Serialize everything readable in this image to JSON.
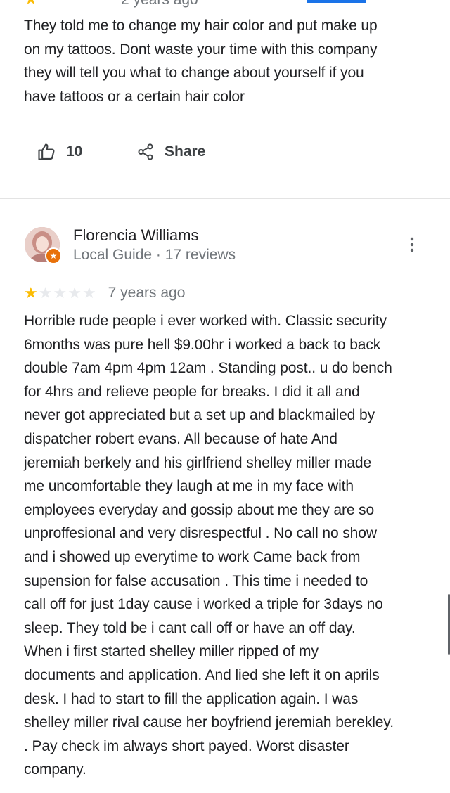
{
  "previous_review": {
    "date_cutoff": "2 years ago",
    "text": "They told me to change my hair color and put make up\non my tattoos. Dont waste your time with this company\nthey will tell you what to change about yourself if you\nhave tattoos or a certain hair color",
    "like_count": "10",
    "share_label": "Share"
  },
  "review": {
    "author_name": "Florencia Williams",
    "author_meta": "Local Guide · 17 reviews",
    "rating": 1,
    "rating_max": 5,
    "date": "7 years ago",
    "text": "Horrible rude people i ever worked with. Classic security\n6months was pure hell $9.00hr i worked a back to back\ndouble 7am 4pm 4pm 12am . Standing post.. u do bench\nfor 4hrs and relieve people for breaks. I did it all and\nnever got appreciated but  a set up and blackmailed by\ndispatcher robert evans. All because of hate  And\njeremiah berkely and his girlfriend shelley miller made\nme uncomfortable they laugh at me in my face with\nemployees everyday and gossip about me they are so\nunproffesional and very disrespectful . No call no show\nand i showed up everytime to work  Came back from\nsupension for false accusation . This time i needed to\ncall off for just 1day cause i worked a triple for 3days no\nsleep. They told be i cant call off or have an off day.\nWhen i first started shelley miller ripped of my\ndocuments and application. And lied she left it on aprils\ndesk. I had to start to fill the application again. I was\nshelley miller rival cause her boyfriend jeremiah berekley.\n.  Pay check im always short payed. Worst disaster\ncompany."
  },
  "icons": {
    "like": "thumbs-up-icon",
    "share": "share-icon",
    "more": "more-vert-icon",
    "local_guide_badge": "star-badge-icon"
  },
  "colors": {
    "star_on": "#fbbc04",
    "star_off": "#e8eaed",
    "secondary_text": "#70757a",
    "badge": "#e8710a",
    "tab_indicator": "#1a73e8"
  }
}
